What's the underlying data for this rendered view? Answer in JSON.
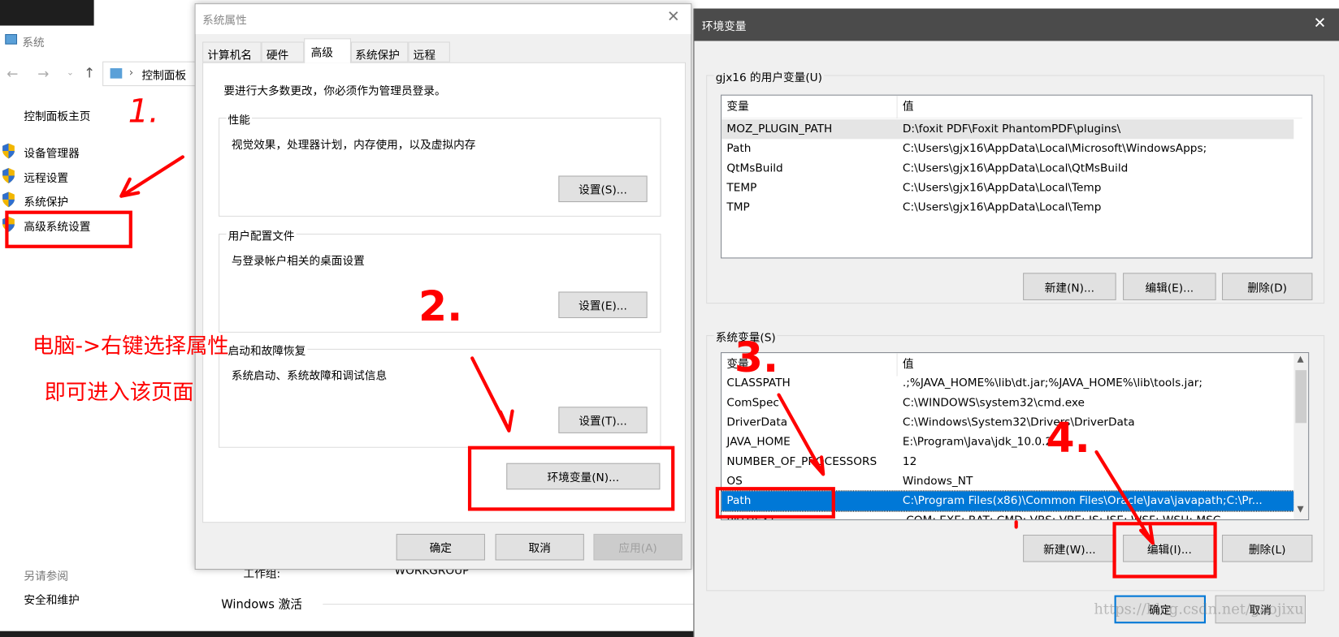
{
  "control_panel": {
    "title": "系统",
    "breadcrumb": "控制面板",
    "home_link": "控制面板主页",
    "nav_items": [
      "设备管理器",
      "远程设置",
      "系统保护",
      "高级系统设置"
    ],
    "see_also": "另请参阅",
    "see_also_link": "安全和维护",
    "workgroup_label": "工作组:",
    "workgroup_value": "WORKGROUP",
    "activation_heading": "Windows 激活"
  },
  "sys_props": {
    "title": "系统属性",
    "tabs": [
      "计算机名",
      "硬件",
      "高级",
      "系统保护",
      "远程"
    ],
    "selected_tab": "高级",
    "admin_note": "要进行大多数更改，你必须作为管理员登录。",
    "groups": [
      {
        "label": "性能",
        "desc": "视觉效果，处理器计划，内存使用，以及虚拟内存",
        "button": "设置(S)..."
      },
      {
        "label": "用户配置文件",
        "desc": "与登录帐户相关的桌面设置",
        "button": "设置(E)..."
      },
      {
        "label": "启动和故障恢复",
        "desc": "系统启动、系统故障和调试信息",
        "button": "设置(T)..."
      }
    ],
    "env_button": "环境变量(N)...",
    "ok": "确定",
    "cancel": "取消",
    "apply": "应用(A)"
  },
  "env_vars": {
    "title": "环境变量",
    "user_group": "gjx16 的用户变量(U)",
    "col_var": "变量",
    "col_val": "值",
    "user_rows": [
      {
        "name": "MOZ_PLUGIN_PATH",
        "value": "D:\\foxit PDF\\Foxit PhantomPDF\\plugins\\"
      },
      {
        "name": "Path",
        "value": "C:\\Users\\gjx16\\AppData\\Local\\Microsoft\\WindowsApps;"
      },
      {
        "name": "QtMsBuild",
        "value": "C:\\Users\\gjx16\\AppData\\Local\\QtMsBuild"
      },
      {
        "name": "TEMP",
        "value": "C:\\Users\\gjx16\\AppData\\Local\\Temp"
      },
      {
        "name": "TMP",
        "value": "C:\\Users\\gjx16\\AppData\\Local\\Temp"
      }
    ],
    "user_buttons": [
      "新建(N)...",
      "编辑(E)...",
      "删除(D)"
    ],
    "system_group": "系统变量(S)",
    "system_rows": [
      {
        "name": "CLASSPATH",
        "value": ".;%JAVA_HOME%\\lib\\dt.jar;%JAVA_HOME%\\lib\\tools.jar;"
      },
      {
        "name": "ComSpec",
        "value": "C:\\WINDOWS\\system32\\cmd.exe"
      },
      {
        "name": "DriverData",
        "value": "C:\\Windows\\System32\\Drivers\\DriverData"
      },
      {
        "name": "JAVA_HOME",
        "value": "E:\\Program\\Java\\jdk_10.0.2"
      },
      {
        "name": "NUMBER_OF_PROCESSORS",
        "value": "12"
      },
      {
        "name": "OS",
        "value": "Windows_NT"
      },
      {
        "name": "Path",
        "value": "C:\\Program Files(x86)\\Common Files\\Oracle\\Java\\javapath;C:\\Pr..."
      },
      {
        "name": "PATHEXT",
        "value": ".COM;.EXE;.BAT;.CMD;.VBS;.VBE;.JS;.JSE;.WSF;.WSH;.MSC"
      }
    ],
    "selected_system_row": "Path",
    "system_buttons": [
      "新建(W)...",
      "编辑(I)...",
      "删除(L)"
    ],
    "ok": "确定",
    "cancel": "取消",
    "selection_color": "#0078d7",
    "titlebar_color": "#4b4b4b"
  },
  "annotations": {
    "step1": "1.",
    "step2": "2.",
    "step3": "3.",
    "step4": "4.",
    "note_line1": "电脑->右键选择属性",
    "note_line2": "即可进入该页面",
    "color": "#ff0000"
  },
  "watermark": "https://blog.csdn.net/gaojixu"
}
